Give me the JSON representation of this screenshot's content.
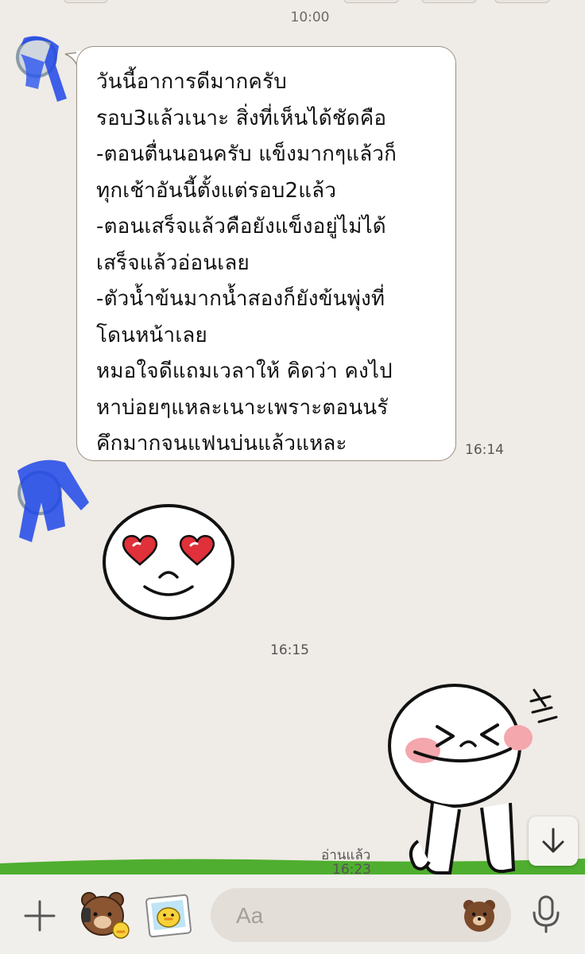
{
  "chat": {
    "date_time": "10:00",
    "messages": [
      {
        "lines": [
          "วันนี้อาการดีมากครับ",
          "รอบ3แล้วเนาะ สิ่งที่เห็นได้ชัดคือ",
          "-ตอนตื่นนอนครับ แข็งมากๆแล้วก็",
          "ทุกเช้าอันนี้ตั้งแต่รอบ2แล้ว",
          "-ตอนเสร็จแล้วคือยังแข็งอยู่ไม่ได้",
          "เสร็จแล้วอ่อนเลย",
          "-ตัวน้ำข้นมากน้ำสองก็ยังข้นพุ่งที่",
          "โดนหน้าเลย",
          "หมอใจดีแถมเวลาให้ คิดว่า คงไป",
          "หาบ่อยๆแหละเนาะเพราะตอนนรั",
          "คึกมากจนแฟนบ่นแล้วแหละ"
        ],
        "time": "16:14"
      }
    ],
    "sticker_in_time": "16:15",
    "read_label": "อ่านแล้ว",
    "read_time": "16:23"
  },
  "stickers": {
    "heart_eyes": "heart-eyes-face-sticker",
    "laughing": "laughing-face-sticker"
  },
  "input": {
    "placeholder": "Aa",
    "icons": [
      "plus-icon",
      "brown-bear-sticker-icon",
      "sally-photo-icon",
      "brown-emoji-icon",
      "microphone-icon"
    ]
  },
  "colors": {
    "background": "#efebe6",
    "bubble": "#ffffff",
    "bubble_border": "#9c8f80",
    "cheek": "#f4a7ad",
    "heart": "#e0303a",
    "grass": "#4fae2f"
  }
}
